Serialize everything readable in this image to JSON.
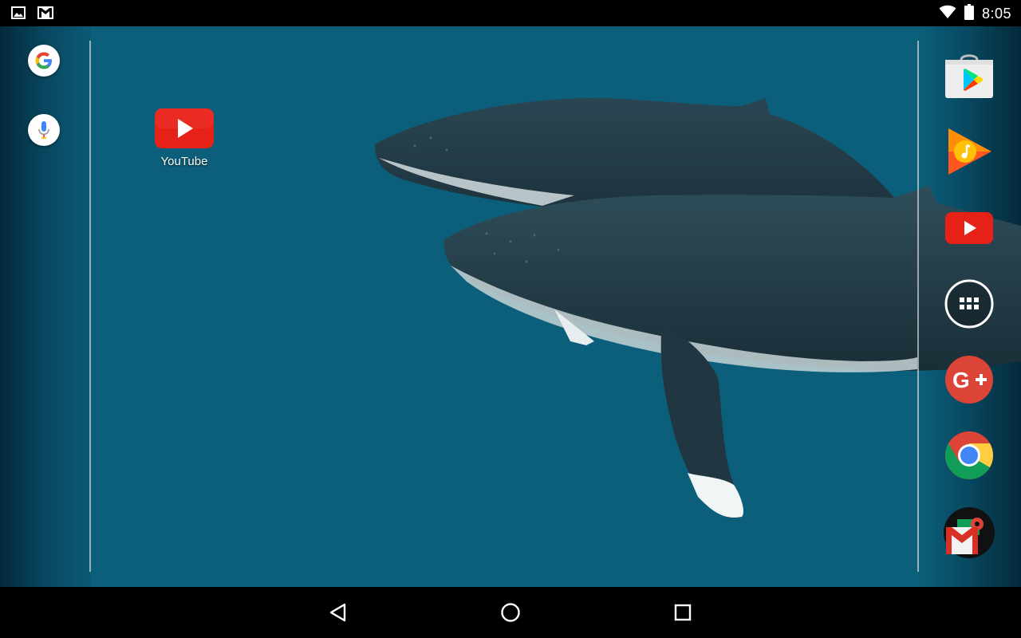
{
  "status_bar": {
    "time": "8:05",
    "icons_left": [
      "image-notification-icon",
      "gmail-notification-icon"
    ],
    "icons_right": [
      "wifi-icon",
      "battery-icon"
    ]
  },
  "search_bar": {
    "items": [
      "google-search-icon",
      "voice-search-icon"
    ]
  },
  "desktop": {
    "shortcuts": [
      {
        "label": "YouTube",
        "icon": "youtube-icon"
      }
    ]
  },
  "dock": {
    "items": [
      "play-store-icon",
      "play-music-icon",
      "youtube-icon",
      "all-apps-icon",
      "google-plus-icon",
      "chrome-icon",
      "gmail-icon"
    ]
  },
  "nav_bar": {
    "buttons": [
      "back-icon",
      "home-icon",
      "recents-icon"
    ]
  },
  "colors": {
    "wallpaper": "#0c5f7a",
    "youtube_red": "#e62117",
    "google_plus_red": "#db4437"
  }
}
